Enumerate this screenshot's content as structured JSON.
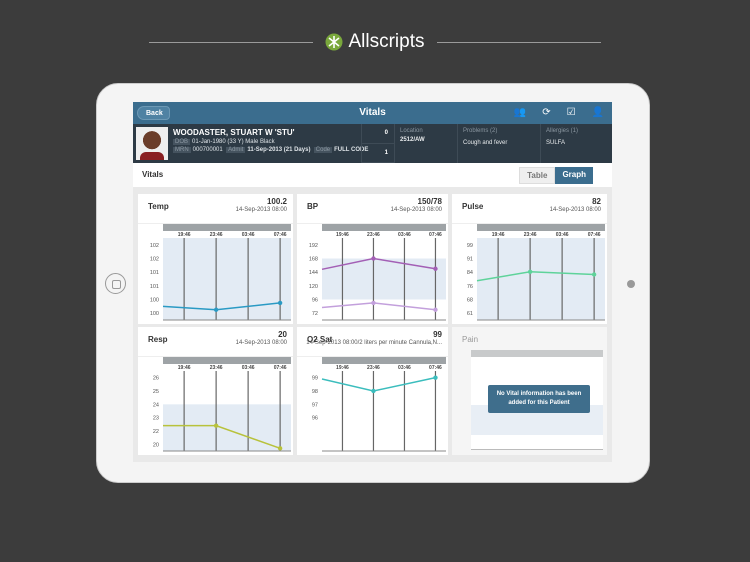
{
  "brand": {
    "name": "Allscripts"
  },
  "header": {
    "back_label": "Back",
    "title": "Vitals",
    "icons": [
      "care-team-icon",
      "refresh-icon",
      "tasks-icon",
      "patient-list-icon"
    ]
  },
  "patient": {
    "name": "WOODASTER, STUART W 'STU'",
    "dob_label": "DOB",
    "dob": "01-Jan-1980 (33 Y) Male Black",
    "mrn_label": "MRN",
    "mrn": "000700001",
    "admit_label": "Admit",
    "admit": "11-Sep-2013 (21 Days)",
    "code_label": "Code",
    "code": "FULL CODE",
    "count_top": "0",
    "count_bottom": "1",
    "location_label": "Location",
    "location": "2512/AW",
    "problems_label": "Problems (2)",
    "problems": "Cough and fever",
    "allergies_label": "Allergies (1)",
    "allergies": "SULFA"
  },
  "section": {
    "title": "Vitals",
    "tabs": [
      {
        "label": "Table",
        "active": false
      },
      {
        "label": "Graph",
        "active": true
      }
    ]
  },
  "times": [
    "19:46",
    "23:46",
    "03:46",
    "07:46"
  ],
  "chart_data": [
    {
      "type": "line",
      "title": "Temp",
      "value": "100.2",
      "date": "14-Sep-2013 08:00",
      "yticks": [
        "102",
        "102",
        "101",
        "101",
        "100",
        "100"
      ],
      "ylim": [
        100.2,
        102.2
      ],
      "band": [
        100.0,
        102.4
      ],
      "series": [
        {
          "color": "#2a9ac4",
          "prev": 100.4,
          "points": [
            {
              "t": "23:46",
              "v": 100.3
            },
            {
              "t": "07:46",
              "v": 100.5
            }
          ]
        }
      ]
    },
    {
      "type": "line",
      "title": "BP",
      "value": "150/78",
      "date": "14-Sep-2013 08:00",
      "yticks": [
        "192",
        "168",
        "144",
        "120",
        "96",
        "72"
      ],
      "ylim": [
        72,
        192
      ],
      "band": [
        96,
        168
      ],
      "series": [
        {
          "color": "#a35fb5",
          "prev": 149,
          "points": [
            {
              "t": "23:46",
              "v": 168
            },
            {
              "t": "07:46",
              "v": 150
            }
          ]
        },
        {
          "color": "#c3a0dc",
          "prev": 82,
          "points": [
            {
              "t": "23:46",
              "v": 90
            },
            {
              "t": "07:46",
              "v": 78
            }
          ]
        }
      ]
    },
    {
      "type": "line",
      "title": "Pulse",
      "value": "82",
      "date": "14-Sep-2013 08:00",
      "yticks": [
        "99",
        "91",
        "84",
        "76",
        "68",
        "61"
      ],
      "ylim": [
        61,
        99
      ],
      "band": [
        57,
        103
      ],
      "series": [
        {
          "color": "#5ed39a",
          "prev": 79,
          "points": [
            {
              "t": "23:46",
              "v": 84
            },
            {
              "t": "07:46",
              "v": 82.5
            }
          ]
        }
      ]
    },
    {
      "type": "line",
      "title": "Resp",
      "value": "20",
      "date": "14-Sep-2013 08:00",
      "yticks": [
        "26",
        "25",
        "24",
        "23",
        "22",
        "20"
      ],
      "ylim": [
        21,
        26
      ],
      "band": [
        20,
        24
      ],
      "series": [
        {
          "color": "#b8c23b",
          "prev": 22.4,
          "points": [
            {
              "t": "23:46",
              "v": 22.4
            },
            {
              "t": "07:46",
              "v": 20.7
            }
          ]
        }
      ]
    },
    {
      "type": "line",
      "title": "O2 Sat",
      "value": "99",
      "date": "14-Sep-2013 08:00/2 liters per minute Cannula,N...",
      "yticks": [
        "99",
        "98",
        "97",
        "96"
      ],
      "ylim": [
        96,
        99
      ],
      "band": null,
      "series": [
        {
          "color": "#3bbdbd",
          "prev": 98.9,
          "points": [
            {
              "t": "23:46",
              "v": 98
            },
            {
              "t": "07:46",
              "v": 99
            }
          ]
        }
      ]
    }
  ],
  "pain": {
    "title": "Pain",
    "message": "No Vital information has been added for this Patient"
  }
}
